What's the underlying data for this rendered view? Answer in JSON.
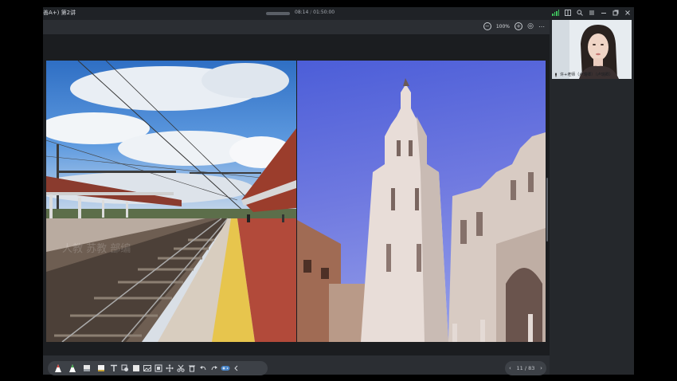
{
  "window": {
    "title": "善A+) 第2讲",
    "time_current": "08:14",
    "time_total": "01:50:00",
    "time_sep": "/",
    "icons": [
      "signal-icon",
      "grid-icon",
      "search-icon",
      "menu-icon",
      "minimize-icon",
      "restore-icon",
      "close-icon"
    ]
  },
  "viewer": {
    "zoom_out": "−",
    "zoom_level": "100%",
    "zoom_in": "+",
    "fit": "◎",
    "more": "⋯"
  },
  "slide": {
    "images": [
      "railway-platform-photo",
      "cathedral-tower-photo"
    ]
  },
  "camera": {
    "name_label": "许+老师（卢瑞卿）（卢瑞卿）"
  },
  "toolbar": {
    "tools": [
      "pen-red",
      "pen-green",
      "eraser",
      "highlighter",
      "text",
      "shape-rect",
      "shape-square",
      "image",
      "square-fill",
      "move",
      "cut",
      "delete",
      "undo",
      "redo",
      "gamepad",
      "collapse"
    ]
  },
  "pagination": {
    "prev": "‹",
    "current": "11",
    "sep": " / ",
    "total": "83",
    "next": "›"
  },
  "colors": {
    "accent_green": "#3fc45e",
    "app_bg": "#2b2e33",
    "stage_bg": "#1b1d20"
  }
}
